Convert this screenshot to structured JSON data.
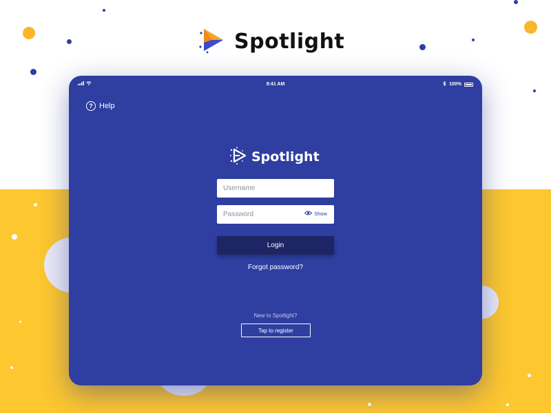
{
  "brand": {
    "name": "Spotlight",
    "colors": {
      "orange": "#f5a623",
      "blue": "#2e3ea1",
      "purple": "#6a3bd0"
    }
  },
  "background": {
    "top_color": "#ffffff",
    "bottom_color": "#fdc72f",
    "dot_blue": "#2e3ea1",
    "dot_yellow": "#f9b62a"
  },
  "tablet": {
    "color": "#2e3ea1",
    "status_bar": {
      "time": "9:41 AM",
      "battery": "100%"
    },
    "help": {
      "icon": "question-circle-icon",
      "label": "Help"
    },
    "logo": {
      "name": "Spotlight",
      "icon": "play-sparkle-icon"
    },
    "form": {
      "username": {
        "placeholder": "Username",
        "value": ""
      },
      "password": {
        "placeholder": "Password",
        "value": "",
        "toggle_label": "Show",
        "toggle_icon": "eye-icon"
      },
      "login_label": "Login",
      "forgot_label": "Forgot password?"
    },
    "register": {
      "prompt": "New to Spotlight?",
      "button_label": "Tap to register"
    }
  }
}
